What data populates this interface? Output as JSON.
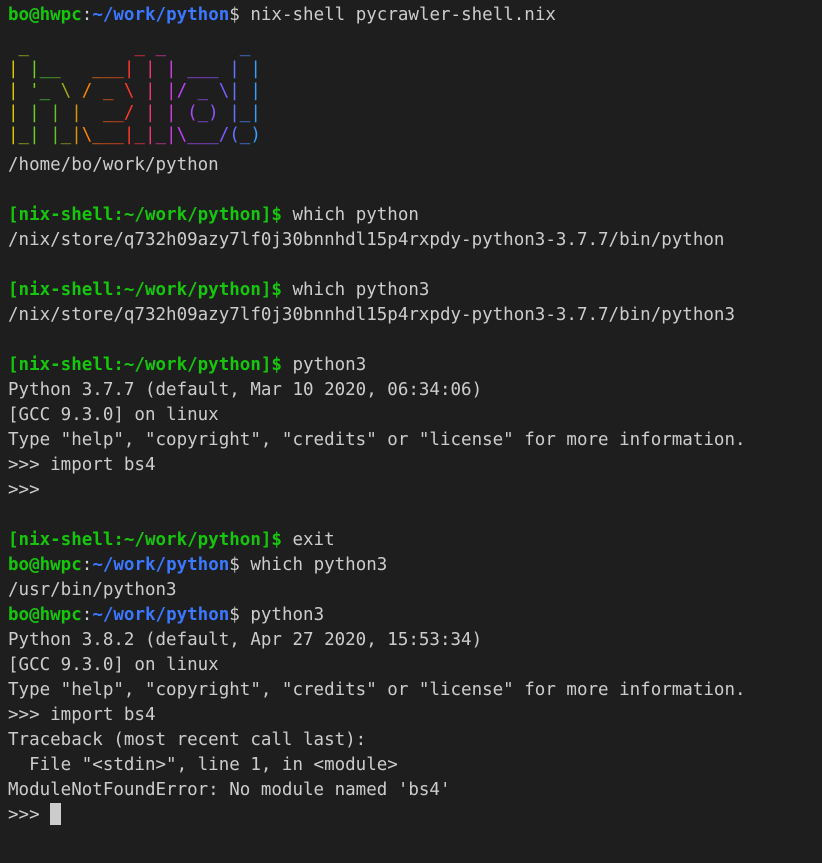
{
  "terminal": {
    "prompt_user_host": "bo@hwpc",
    "prompt_sep": ":",
    "prompt_path": "~/work/python",
    "prompt_dollar": "$",
    "nix_prompt": "[nix-shell:~/work/python]$",
    "colors": {
      "background": "#1e1e1e",
      "text": "#cccccc",
      "green": "#16c60c",
      "blue": "#3b78ff"
    },
    "banner_ascii": [
      " _          _ _       _ ",
      "| |__   ___| | | ___ | |",
      "| '_ \\ / _ \\ | |/ _ \\| |",
      "| | | |  __/ | | (_) |_|",
      "|_| |_|\\___|_|_|\\___/(_)"
    ],
    "lines": {
      "cmd1": " nix-shell pycrawler-shell.nix",
      "pwd_out": "/home/bo/work/python",
      "cmd2": " which python",
      "out2": "/nix/store/q732h09azy7lf0j30bnnhdl15p4rxpdy-python3-3.7.7/bin/python",
      "cmd3": " which python3",
      "out3": "/nix/store/q732h09azy7lf0j30bnnhdl15p4rxpdy-python3-3.7.7/bin/python3",
      "cmd4": " python3",
      "py1_ver": "Python 3.7.7 (default, Mar 10 2020, 06:34:06)",
      "py1_gcc": "[GCC 9.3.0] on linux",
      "py1_type": "Type \"help\", \"copyright\", \"credits\" or \"license\" for more information.",
      "py1_import": ">>> import bs4",
      "py1_prompt": ">>>",
      "cmd5": " exit",
      "cmd6": " which python3",
      "out6": "/usr/bin/python3",
      "cmd7": " python3",
      "py2_ver": "Python 3.8.2 (default, Apr 27 2020, 15:53:34)",
      "py2_gcc": "[GCC 9.3.0] on linux",
      "py2_type": "Type \"help\", \"copyright\", \"credits\" or \"license\" for more information.",
      "py2_import": ">>> import bs4",
      "tb1": "Traceback (most recent call last):",
      "tb2": "  File \"<stdin>\", line 1, in <module>",
      "tb3": "ModuleNotFoundError: No module named 'bs4'",
      "final_prompt": ">>> "
    }
  }
}
